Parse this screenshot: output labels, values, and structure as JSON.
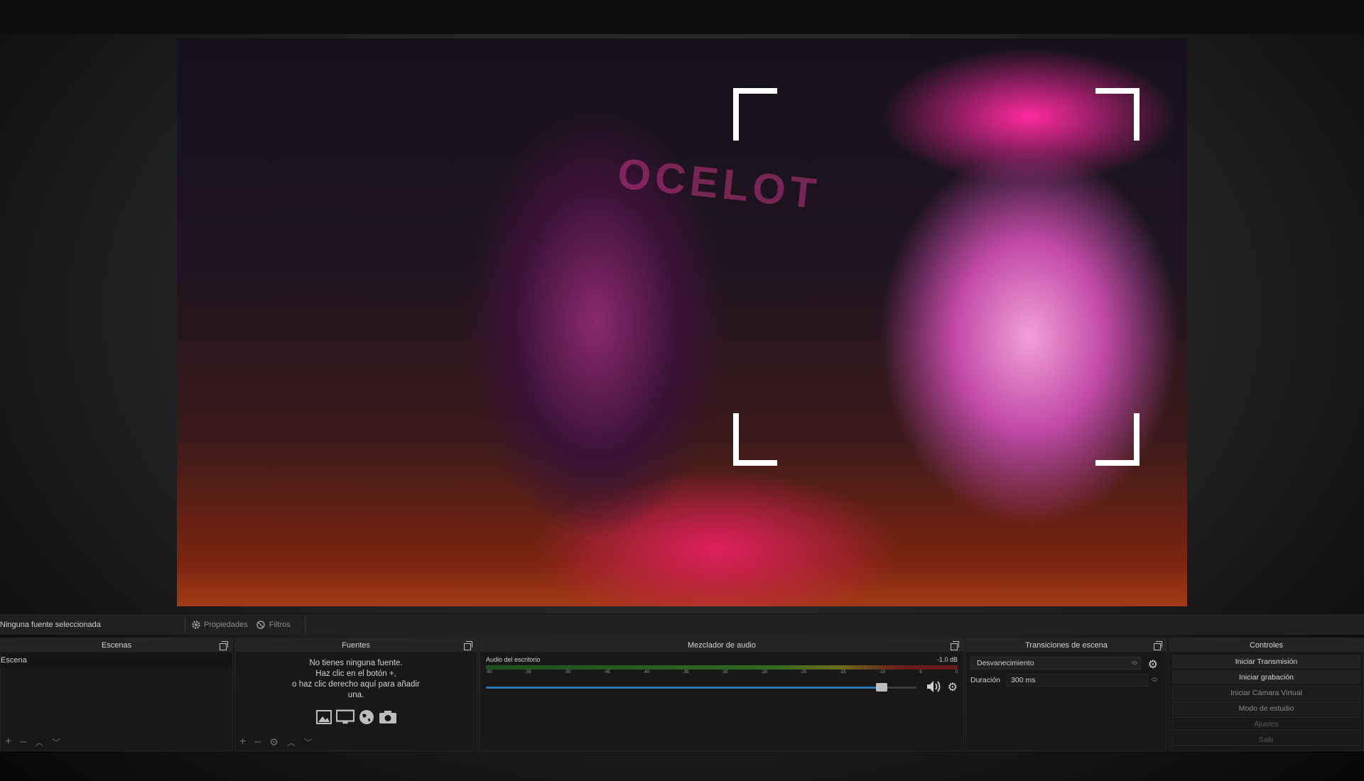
{
  "preview": {
    "scene_graphic_text": "OCELOT"
  },
  "statusbar": {
    "selected_source": "Ninguna fuente seleccionada",
    "properties_label": "Propiedades",
    "filters_label": "Filtros"
  },
  "docks": {
    "scenes": {
      "title": "Escenas",
      "items": [
        "Escena"
      ]
    },
    "sources": {
      "title": "Fuentes",
      "empty_line1": "No tienes ninguna fuente.",
      "empty_line2": "Haz clic en el botón +,",
      "empty_line3": "o haz clic derecho aquí para añadir",
      "empty_line4": "una."
    },
    "mixer": {
      "title": "Mezclador de audio",
      "channel_name": "Audio del escritorio",
      "level": "-1.0 dB",
      "ticks": [
        "-60",
        "-55",
        "-50",
        "-45",
        "-40",
        "-35",
        "-30",
        "-25",
        "-20",
        "-15",
        "-10",
        "-5",
        "0"
      ],
      "fader_level": 0.92
    },
    "transitions": {
      "title": "Transiciones de escena",
      "selected": "Desvanecimiento",
      "duration_label": "Duración",
      "duration_value": "300 ms"
    },
    "controls": {
      "title": "Controles",
      "buttons": [
        "Iniciar Transmisión",
        "Iniciar grabación",
        "Iniciar Cámara Virtual",
        "Modo de estudio",
        "Ajustes",
        "Salir"
      ]
    }
  },
  "icons": {
    "add": "plus-icon",
    "remove": "minus-icon",
    "settings": "gear-icon",
    "up": "chevron-up-icon",
    "down": "chevron-down-icon"
  },
  "colors": {
    "accent_blue": "#2d74b8",
    "brand_pink": "#ff2aa0"
  }
}
